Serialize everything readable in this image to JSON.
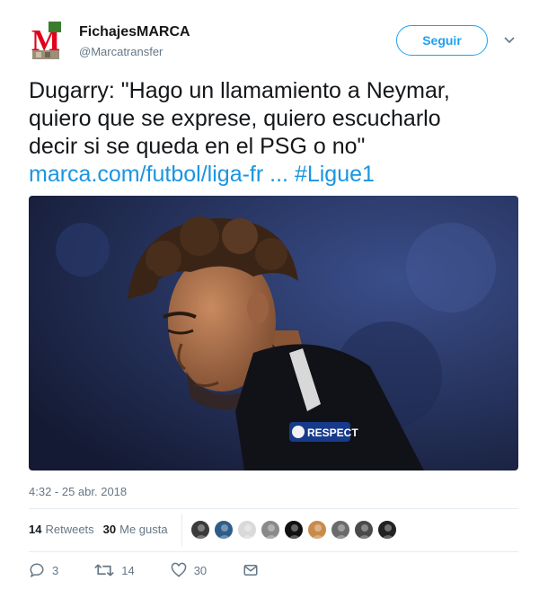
{
  "author": {
    "name": "FichajesMARCA",
    "handle": "@Marcatransfer",
    "logo_letter": "M"
  },
  "follow_button": {
    "label": "Seguir"
  },
  "tweet": {
    "lines": [
      "Dugarry: \"Hago un llamamiento a Neymar,",
      "quiero que se exprese,  quiero escucharlo",
      "decir si se queda en el PSG o no\""
    ],
    "link_text": "marca.com/futbol/liga-fr",
    "ellipsis": " ... ",
    "hashtag": "#Ligue1"
  },
  "media": {
    "badge_text": "RESPECT"
  },
  "timestamp": "4:32 - 25 abr. 2018",
  "stats": {
    "retweets_count": "14",
    "retweets_label": "Retweets",
    "likes_count": "30",
    "likes_label": "Me gusta"
  },
  "likers": [
    {
      "icon": "liker-avatar",
      "color": "#3b3b3b"
    },
    {
      "icon": "liker-avatar",
      "color": "#2f5d8a"
    },
    {
      "icon": "liker-avatar",
      "color": "#d9d9d9"
    },
    {
      "icon": "liker-avatar",
      "color": "#8a8a8a"
    },
    {
      "icon": "liker-avatar",
      "color": "#111111"
    },
    {
      "icon": "liker-avatar",
      "color": "#c98b4b"
    },
    {
      "icon": "liker-avatar",
      "color": "#6b6b6b"
    },
    {
      "icon": "liker-avatar",
      "color": "#4a4a4a"
    },
    {
      "icon": "liker-avatar",
      "color": "#222222"
    }
  ],
  "actions": {
    "replies": "3",
    "retweets": "14",
    "likes": "30"
  },
  "colors": {
    "accent": "#1da1f2",
    "link": "#1b95e0",
    "muted": "#657786",
    "marca_red": "#e2001a"
  }
}
